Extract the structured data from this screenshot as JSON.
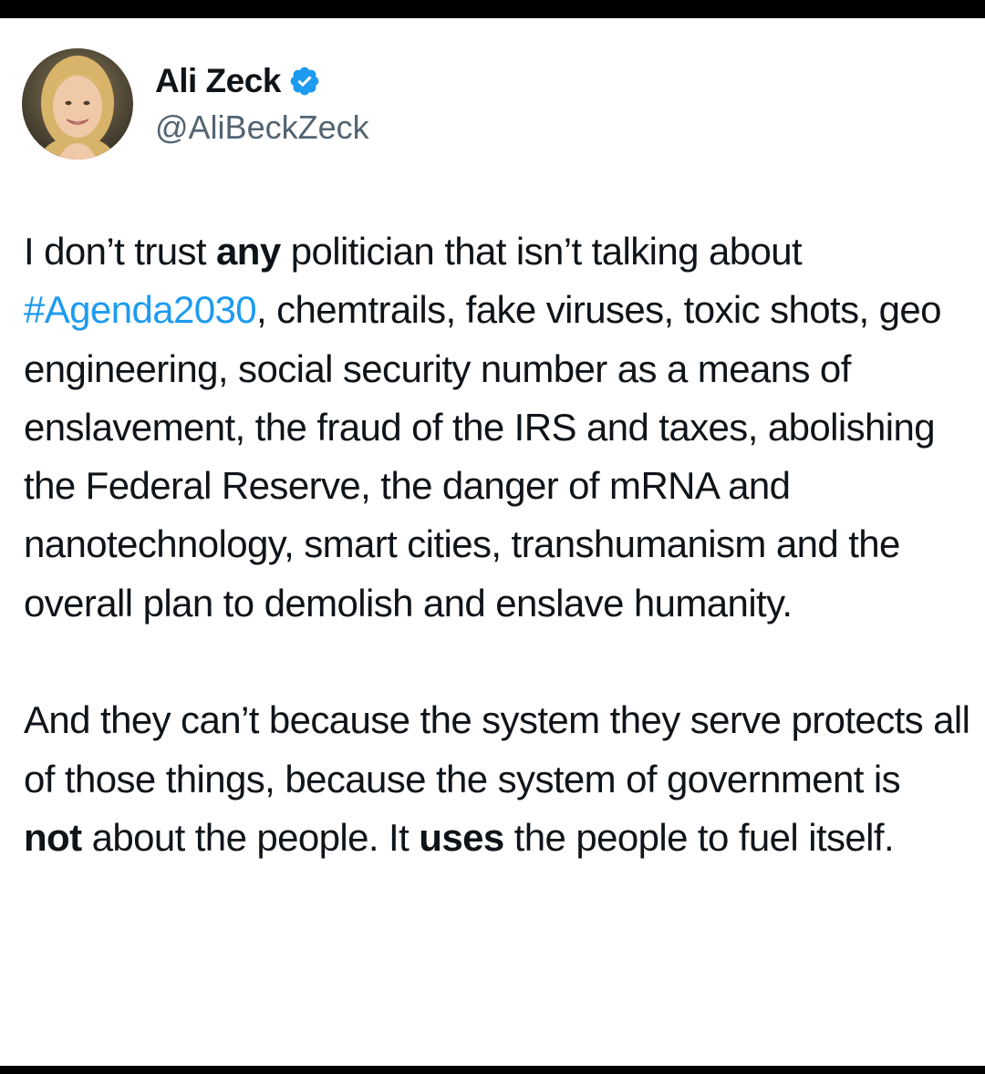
{
  "tweet": {
    "author": {
      "display_name": "Ali Zeck",
      "handle": "@AliBeckZeck",
      "verified_icon": "verified-badge-icon",
      "verified_color": "#1d9bf0"
    },
    "paragraph1": {
      "t1": "I don’t trust ",
      "b1": "any",
      "t2": " politician that isn’t talking about ",
      "hashtag": "#Agenda2030",
      "t3": ", chemtrails, fake viruses, toxic shots, geo engineering, social security number as a means of enslavement, the fraud of the IRS and taxes, abolishing the Federal Reserve, the danger of mRNA and nanotechnology, smart cities, transhumanism and the overall plan to demolish and enslave humanity."
    },
    "paragraph2": {
      "t1": "And they can’t because the system they serve protects all of those things, because the system of government is"
    },
    "paragraph3": {
      "b1": "not",
      "t1": " about the people. It ",
      "b2": "uses",
      "t2": " the people to fuel itself."
    }
  },
  "colors": {
    "text": "#0f1419",
    "secondary_text": "#536471",
    "link": "#1d9bf0",
    "background": "#ffffff",
    "frame": "#000000"
  }
}
